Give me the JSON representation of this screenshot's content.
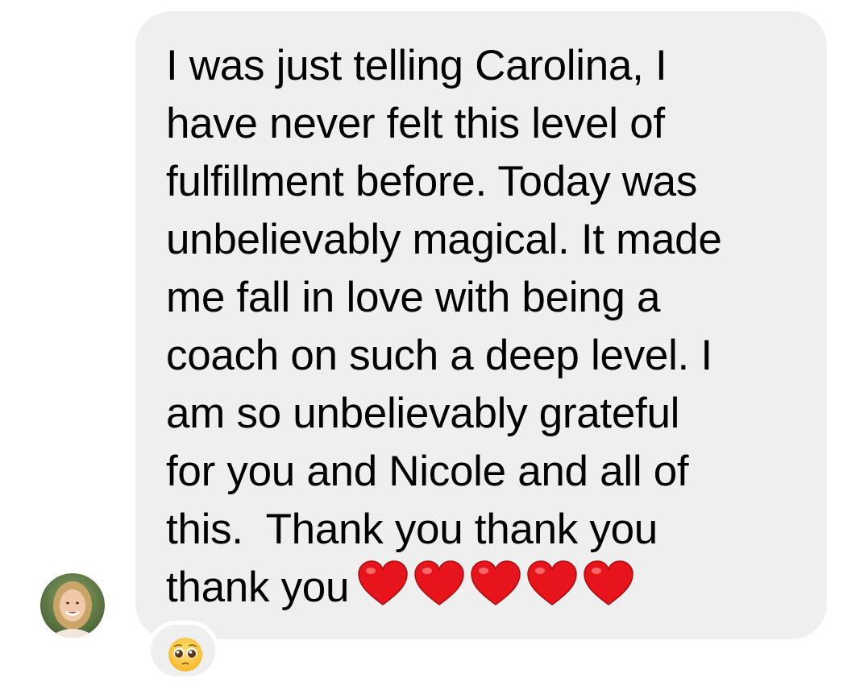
{
  "message": {
    "lines": [
      "I was just telling Carolina, I",
      "have never felt this level of",
      "fulfillment before. Today was",
      "unbelievably magical. It made",
      "me fall in love with being a",
      "coach on such a deep level. I",
      "am so unbelievably grateful",
      "for you and Nicole and all of",
      "this.  Thank you thank you",
      "thank you"
    ],
    "heart_count": 5,
    "heart_icon": "red-heart-icon",
    "bubble_color": "#efefef",
    "heart_color": "#e8141c"
  },
  "sender": {
    "avatar_icon": "avatar-photo"
  },
  "reaction": {
    "emoji_icon": "pleading-face-icon"
  }
}
